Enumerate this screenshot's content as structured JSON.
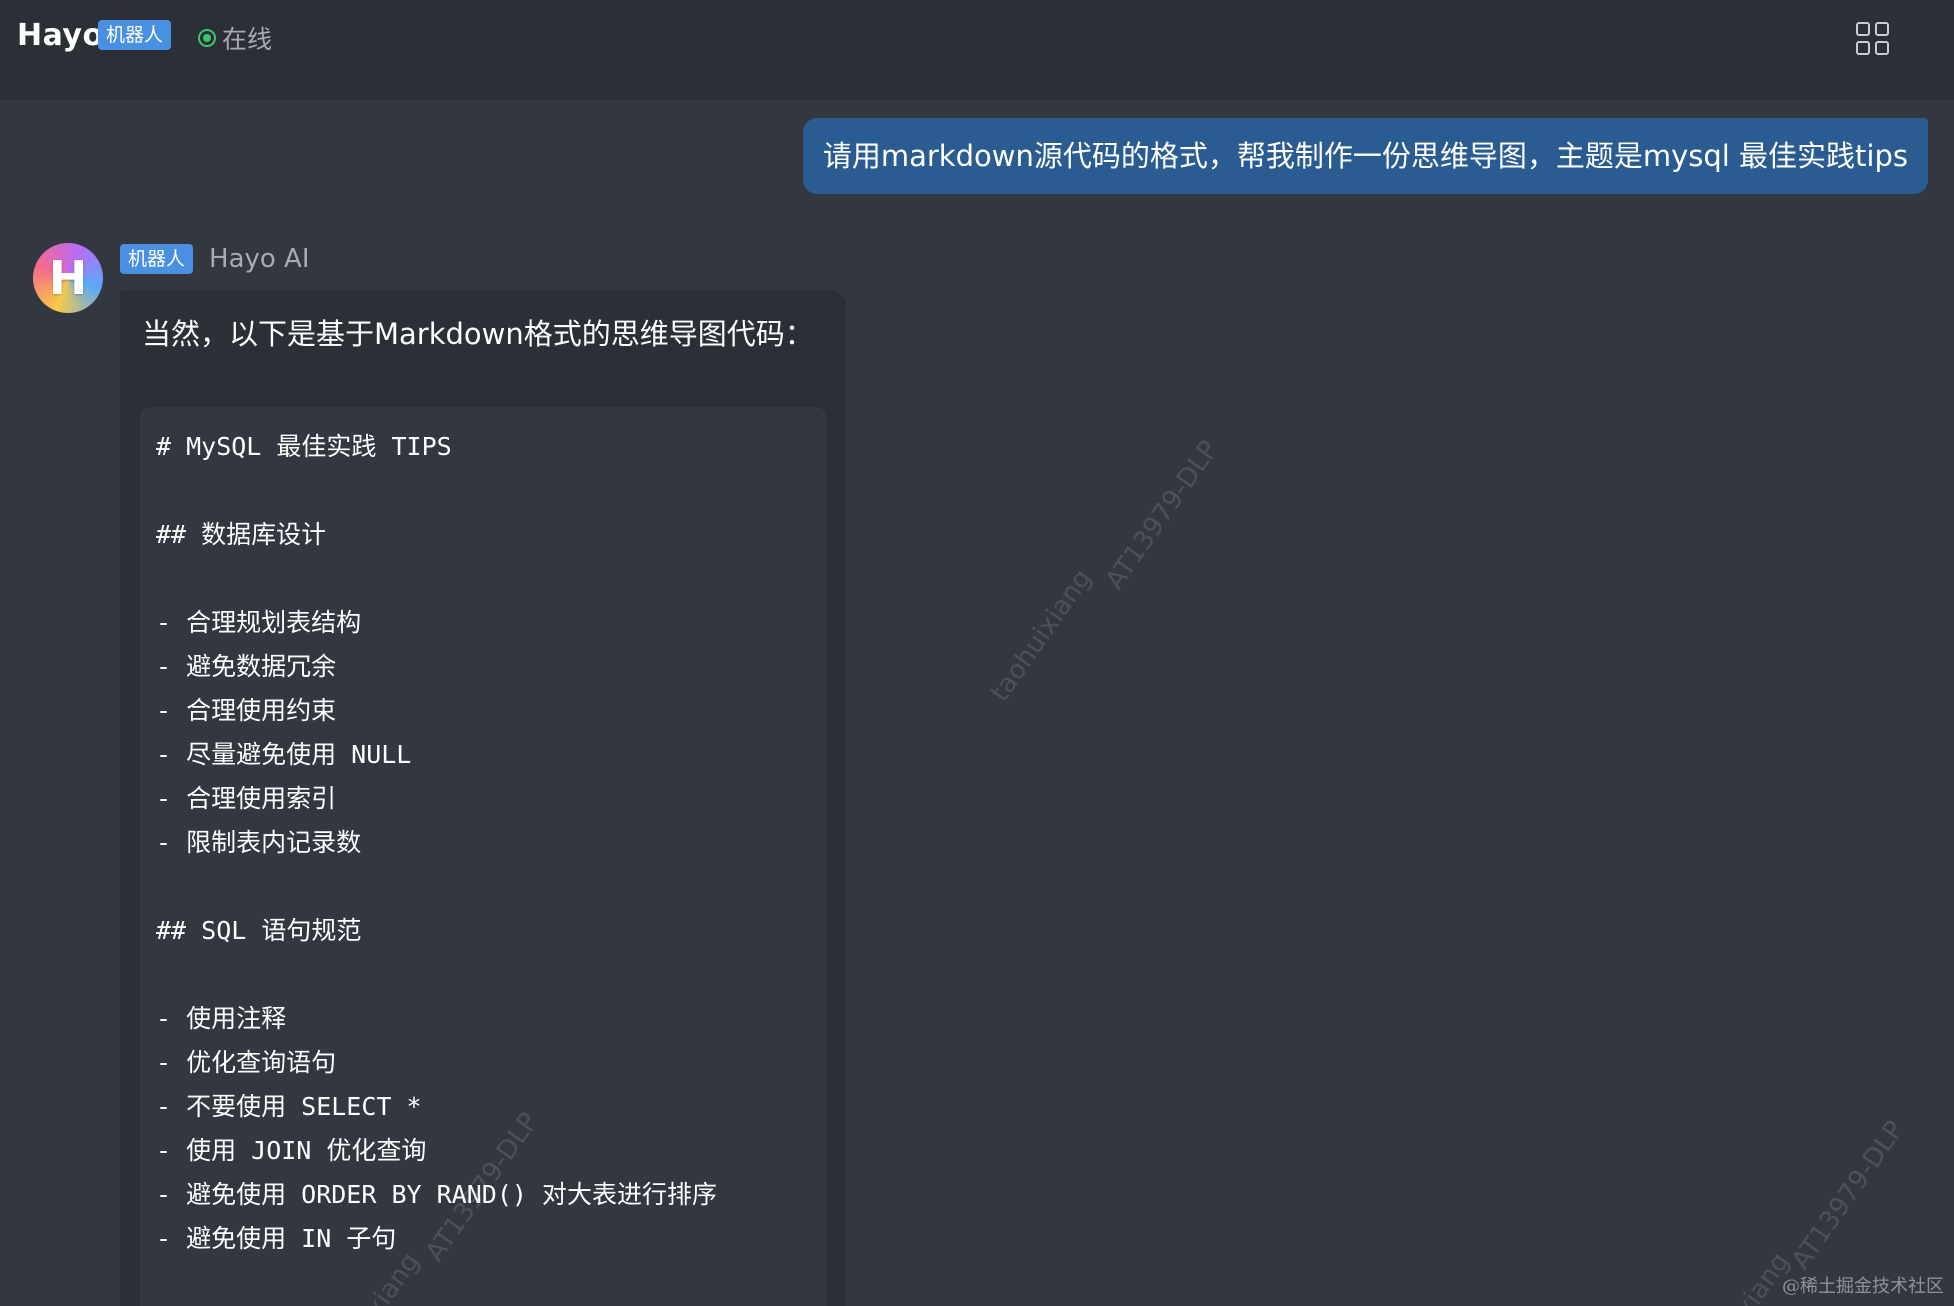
{
  "header": {
    "title": "Hayo",
    "tag": "机器人",
    "status": "在线",
    "apps_icon": "grid-apps-icon"
  },
  "user_message": {
    "text": "请用markdown源代码的格式，帮我制作一份思维导图，主题是mysql 最佳实践tips"
  },
  "bot": {
    "avatar_letter": "H",
    "tag": "机器人",
    "name": "Hayo AI",
    "intro": "当然，以下是基于Markdown格式的思维导图代码：",
    "code_lines": [
      "# MySQL 最佳实践 TIPS",
      "",
      "## 数据库设计",
      "",
      "- 合理规划表结构",
      "- 避免数据冗余",
      "- 合理使用约束",
      "- 尽量避免使用 NULL",
      "- 合理使用索引",
      "- 限制表内记录数",
      "",
      "## SQL 语句规范",
      "",
      "- 使用注释",
      "- 优化查询语句",
      "- 不要使用 SELECT *",
      "- 使用 JOIN 优化查询",
      "- 避免使用 ORDER BY RAND() 对大表进行排序",
      "- 避免使用 IN 子句"
    ]
  },
  "watermarks": [
    "taohuixiang",
    "AT13979-DLP",
    "AT13979-DLP",
    "xiang",
    "AT13979-DLP",
    "xiang"
  ],
  "footer_mark": "@稀土掘金技术社区",
  "colors": {
    "background": "#323740",
    "header": "#2b2f36",
    "user_bubble": "#2b5c91",
    "tag": "#4a90e2",
    "online": "#3cc56a"
  }
}
